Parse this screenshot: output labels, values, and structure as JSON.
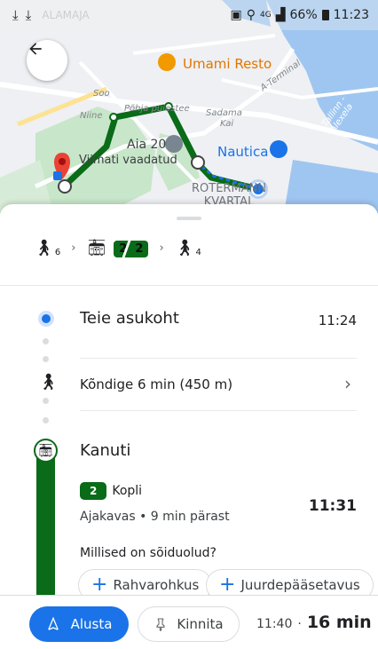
{
  "status_bar": {
    "left_icons": [
      "download-icon",
      "download-icon"
    ],
    "faded_text": "ALAMAJA",
    "network": "4G",
    "battery": "66%",
    "time": "11:23"
  },
  "map": {
    "poi_umami": "Umami Resto",
    "poi_nautica": "Nautica",
    "poi_aia": "Aia 20",
    "poi_viimati": "Viimati vaadatud",
    "poi_roterman_1": "ROTERMANN",
    "poi_roterman_2": "KVARTAL",
    "street_soo": "Soo",
    "street_niine": "Niine",
    "street_sadama": "Sadama",
    "street_kai": "Kai",
    "street_a_terminal": "A-Terminal",
    "street_tallinn": "Tallinn - Alexela",
    "street_parnu": "Põhja puiestee",
    "route_color": "#0a6b18",
    "water_color": "#9fc6f0",
    "park_color": "#c8e6c9"
  },
  "route_summary": {
    "walk1_sub": "6",
    "line_label": "2",
    "walk2_sub": "4"
  },
  "steps": {
    "origin_title": "Teie asukoht",
    "origin_time": "11:24",
    "walk_text": "Kõndige 6 min (450 m)",
    "stop_title": "Kanuti",
    "line_number": "2",
    "line_destination": "Kopli",
    "schedule_text": "Ajakavas • 9 min pärast",
    "depart_time": "11:31",
    "question": "Millised on sõiduolud?",
    "chip_crowding": "Rahvarohkus",
    "chip_access": "Juurdepääsetavus"
  },
  "bottom_bar": {
    "start_label": "Alusta",
    "pin_label": "Kinnita",
    "arrival_time": "11:40",
    "separator": "·",
    "duration": "16 min"
  },
  "colors": {
    "accent": "#1a73e8",
    "transit_green": "#0a6b18",
    "poi_orange": "#e37400"
  }
}
